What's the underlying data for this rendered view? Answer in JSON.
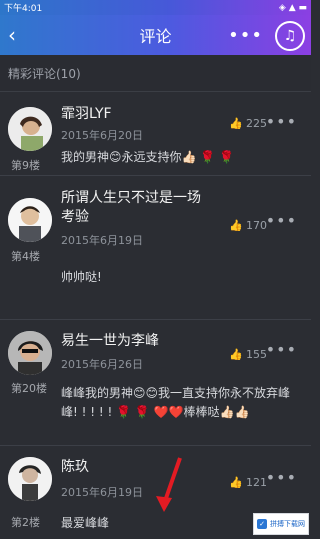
{
  "status": {
    "time": "下午4:01",
    "signal": "◈ ▲ ▬"
  },
  "header": {
    "title": "评论",
    "more": "•••",
    "music_icon": "♫"
  },
  "section": {
    "label": "精彩评论(10)"
  },
  "comments": [
    {
      "name": "霏羽LYF",
      "date": "2015年6月20日",
      "likes": "225",
      "floor": "第9楼",
      "text": "我的男神😊永远支持你👍🏻 🌹 🌹"
    },
    {
      "name": "所谓人生只不过是一场考验",
      "date": "2015年6月19日",
      "likes": "170",
      "floor": "第4楼",
      "text": "帅帅哒!"
    },
    {
      "name": "易生一世为李峰",
      "date": "2015年6月26日",
      "likes": "155",
      "floor": "第20楼",
      "text": "峰峰我的男神😊😊我一直支持你永不放弃峰峰! ! ! ! ! 🌹 🌹 ❤️❤️棒棒哒👍🏻👍🏻"
    },
    {
      "name": "陈玖",
      "date": "2015年6月19日",
      "likes": "121",
      "floor": "第2楼",
      "text": "最爱峰峰"
    }
  ],
  "watermark": {
    "text": "拼搏下载网"
  }
}
